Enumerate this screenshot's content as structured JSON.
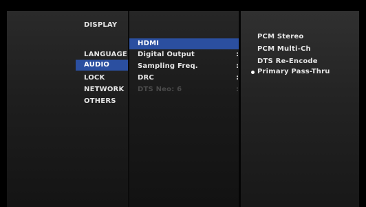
{
  "main_menu": {
    "items": [
      {
        "label": "DISPLAY"
      },
      {
        "label": "LANGUAGE"
      },
      {
        "label": "AUDIO",
        "selected": true
      },
      {
        "label": "LOCK"
      },
      {
        "label": "NETWORK"
      },
      {
        "label": "OTHERS"
      }
    ]
  },
  "audio_menu": {
    "items": [
      {
        "label": "HDMI",
        "selected": true
      },
      {
        "label": "Digital Output"
      },
      {
        "label": "Sampling Freq."
      },
      {
        "label": "DRC"
      },
      {
        "label": "DTS Neo: 6",
        "disabled": true
      }
    ],
    "separator": ":"
  },
  "hdmi_options": {
    "items": [
      {
        "label": "PCM Stereo"
      },
      {
        "label": "PCM Multi-Ch"
      },
      {
        "label": "DTS Re-Encode"
      },
      {
        "label": "Primary Pass-Thru",
        "selected": true
      }
    ]
  },
  "colors": {
    "selection": "#2b4fa0",
    "text": "#e6e6e6",
    "disabled_text": "#4a4a4a",
    "background": "#000000"
  }
}
